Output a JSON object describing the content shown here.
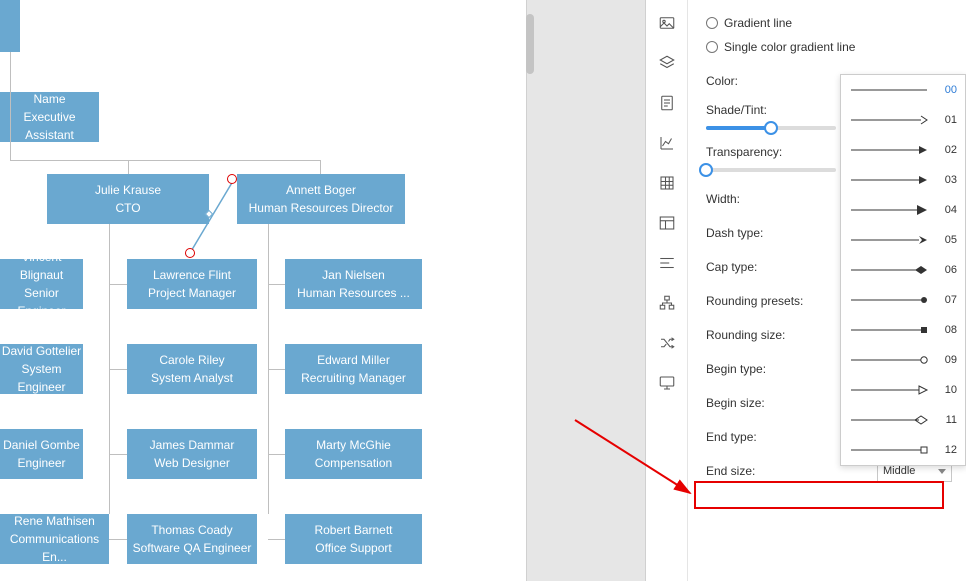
{
  "org": {
    "top_box": {
      "line1": "Name",
      "line2": "Executive Assistant"
    },
    "mid": [
      {
        "line1": "Julie Krause",
        "line2": "CTO"
      },
      {
        "line1": "Annett Boger",
        "line2": "Human Resources Director"
      }
    ],
    "rows": [
      [
        {
          "line1": "Vincent Blignaut",
          "line2": "Senior Engineer"
        },
        {
          "line1": "Lawrence Flint",
          "line2": "Project Manager"
        },
        {
          "line1": "Jan Nielsen",
          "line2": "Human Resources ..."
        }
      ],
      [
        {
          "line1": "David Gottelier",
          "line2": "System Engineer"
        },
        {
          "line1": "Carole Riley",
          "line2": "System Analyst"
        },
        {
          "line1": "Edward Miller",
          "line2": "Recruiting Manager"
        }
      ],
      [
        {
          "line1": "Daniel Gombe",
          "line2": "Engineer"
        },
        {
          "line1": "James Dammar",
          "line2": "Web Designer"
        },
        {
          "line1": "Marty McGhie",
          "line2": "Compensation"
        }
      ],
      [
        {
          "line1": "Rene Mathisen",
          "line2": "Communications En..."
        },
        {
          "line1": "Thomas Coady",
          "line2": "Software QA Engineer"
        },
        {
          "line1": "Robert Barnett",
          "line2": "Office Support"
        }
      ]
    ]
  },
  "panel": {
    "radio1": "Gradient line",
    "radio2": "Single color gradient line",
    "color": "Color:",
    "shade": "Shade/Tint:",
    "transparency": "Transparency:",
    "width": "Width:",
    "dash": "Dash type:",
    "cap": "Cap type:",
    "round_presets": "Rounding presets:",
    "round_size": "Rounding size:",
    "begin_type": "Begin type:",
    "begin_size": "Begin size:",
    "end_type": "End type:",
    "end_size": "End size:",
    "end_type_value": "00",
    "end_size_value": "Middle"
  },
  "popup": {
    "items": [
      "00",
      "01",
      "02",
      "03",
      "04",
      "05",
      "06",
      "07",
      "08",
      "09",
      "10",
      "11",
      "12"
    ]
  },
  "icons": [
    "image",
    "layers",
    "note",
    "chart",
    "grid",
    "layout",
    "align",
    "org",
    "random",
    "present"
  ]
}
